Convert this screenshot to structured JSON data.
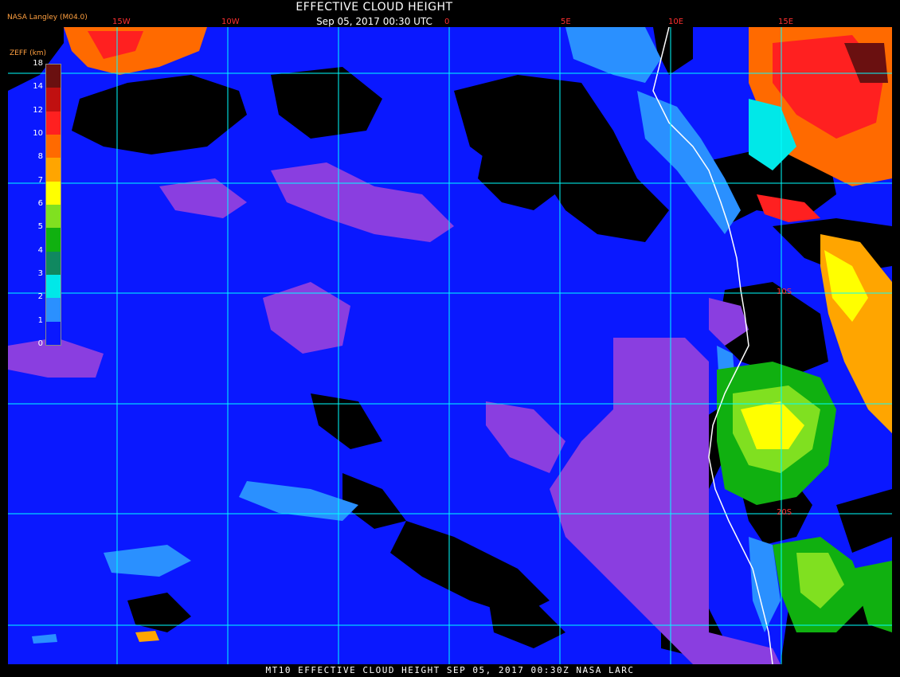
{
  "header": {
    "agency": "NASA Langley (M04.0)",
    "title": "EFFECTIVE CLOUD HEIGHT",
    "subtitle": "Sep 05, 2017 00:30 UTC"
  },
  "footer": {
    "text": "MT10  EFFECTIVE CLOUD HEIGHT   SEP 05, 2017 00:30Z   NASA LARC"
  },
  "map": {
    "longitude_labels": [
      "15W",
      "10W",
      "0",
      "5E",
      "10E",
      "15E"
    ],
    "latitude_labels": [
      "10S",
      "20S"
    ]
  },
  "colorbar": {
    "title": "ZEFF (km)",
    "ticks": [
      "18",
      "14",
      "12",
      "10",
      "8",
      "7",
      "6",
      "5",
      "4",
      "3",
      "2",
      "1",
      "0"
    ],
    "colors": [
      "#6a1010",
      "#c01010",
      "#ff2020",
      "#ff6a00",
      "#ffa500",
      "#ffff00",
      "#80e020",
      "#10b010",
      "#108860",
      "#00e8e8",
      "#2a90ff",
      "#0a18ff",
      "#9040d0"
    ]
  },
  "legend_colors": {
    "background": "#000000",
    "ocean_low": "#0a18ff",
    "very_low": "#8a3ee0",
    "grid": "#00ffff",
    "coast": "#ffffff"
  }
}
